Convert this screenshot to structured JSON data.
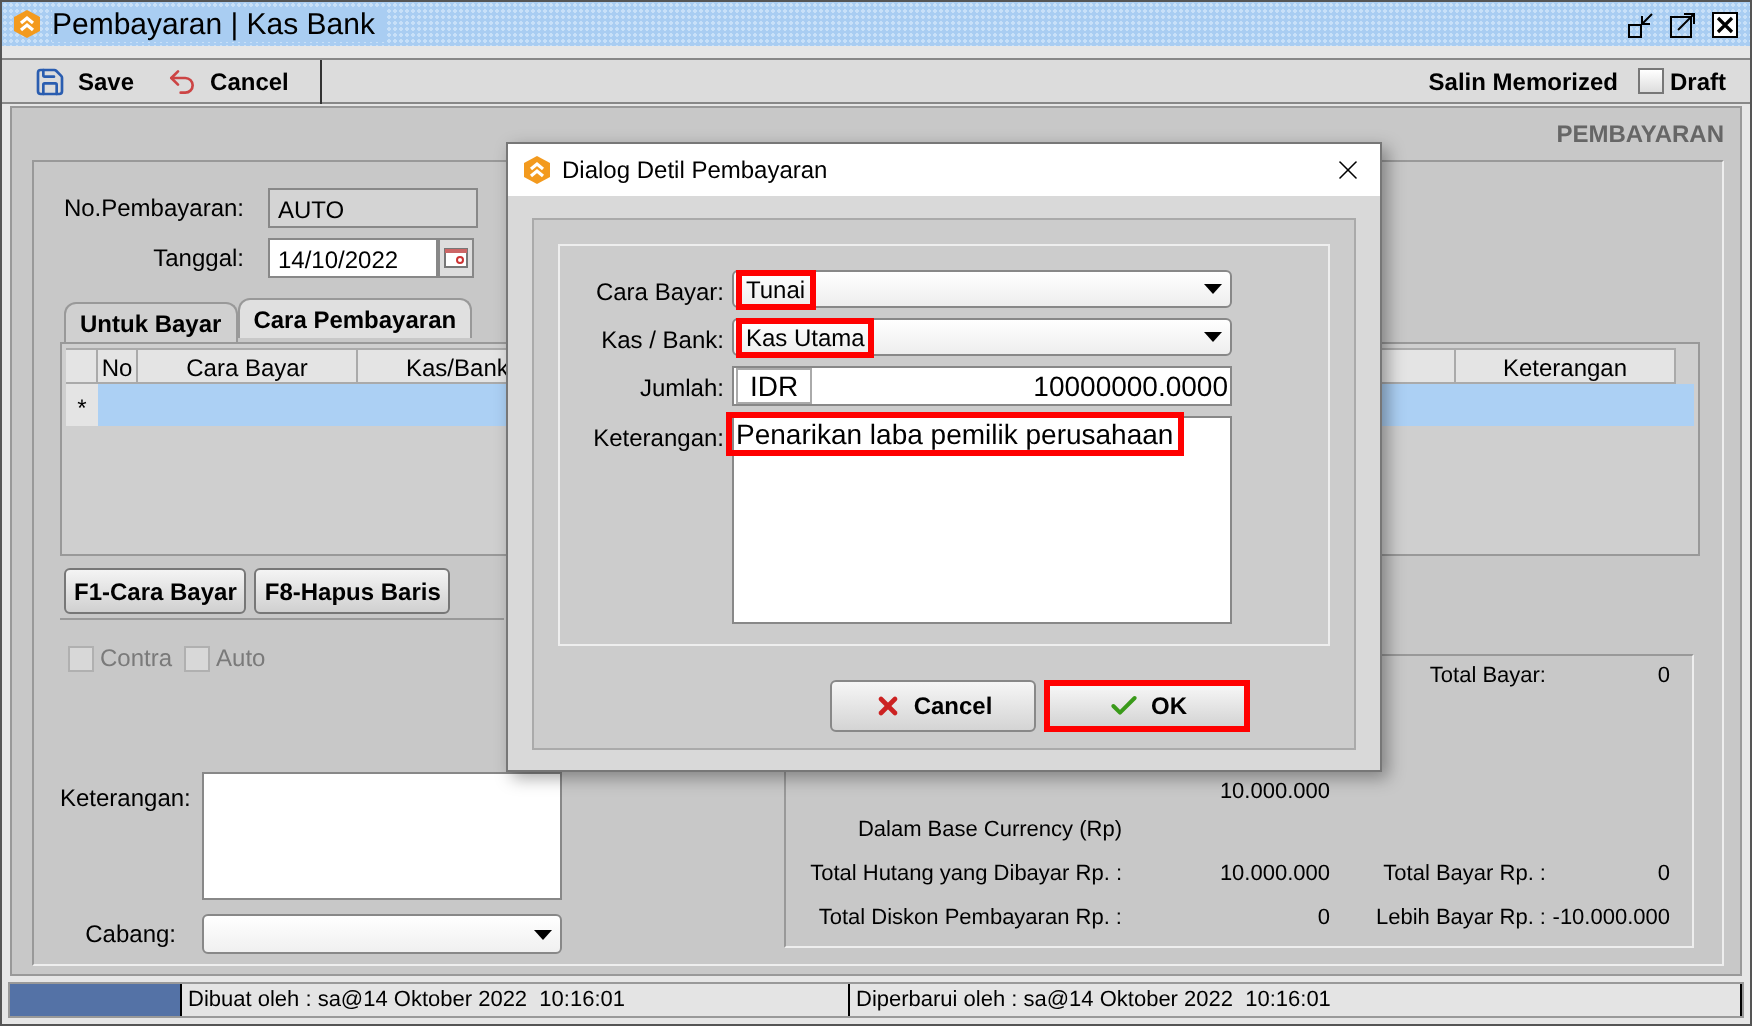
{
  "window": {
    "title": "Pembayaran | Kas Bank"
  },
  "toolbar": {
    "buttons": [
      {
        "label": "Save",
        "kind": "save"
      },
      {
        "label": "Cancel",
        "kind": "cancel"
      }
    ],
    "memorized": "Salin Memorized",
    "draft": {
      "label": "Draft",
      "checked": false
    }
  },
  "form_type": "PEMBAYARAN",
  "fields": [
    {
      "label": "No.Pembayaran:",
      "value": "AUTO",
      "kind": "readonly"
    },
    {
      "label": "Tanggal:",
      "value": "14/10/2022",
      "kind": "date"
    }
  ],
  "tabs": [
    {
      "label": "Untuk Bayar",
      "selected": false
    },
    {
      "label": "Cara Pembayaran",
      "selected": true
    }
  ],
  "table": {
    "columns": [
      "No",
      "Cara Bayar",
      "Kas/Bank",
      "Keterangan"
    ],
    "rows": [
      {
        "marker": "*",
        "selected": true
      }
    ]
  },
  "table_buttons": [
    "F1-Cara Bayar",
    "F8-Hapus Baris"
  ],
  "options": [
    {
      "label": "Contra",
      "checked": false,
      "disabled": true
    },
    {
      "label": "Auto",
      "checked": false,
      "disabled": true
    }
  ],
  "keterangan": {
    "label": "Keterangan:"
  },
  "cabang": {
    "label": "Cabang:"
  },
  "summary": {
    "total_bayar": {
      "label": "Total Bayar:",
      "value": "0"
    },
    "amount": "10.000.000",
    "base_currency": "Dalam Base Currency (Rp)",
    "rows": [
      {
        "label": "Total Hutang yang Dibayar Rp. :",
        "value": "10.000.000",
        "label_2": "Total Bayar Rp. :",
        "value_2": "0"
      },
      {
        "label": "Total Diskon Pembayaran Rp. :",
        "value": "0",
        "label_2": "Lebih Bayar Rp. :",
        "value_2": "-10.000.000"
      }
    ]
  },
  "status_bar": {
    "created": "Dibuat oleh : sa@14 Oktober 2022  10:16:01",
    "updated": "Diperbarui oleh : sa@14 Oktober 2022  10:16:01"
  },
  "dialog": {
    "title": "Dialog Detil Pembayaran",
    "fields": [
      {
        "label": "Cara Bayar:",
        "kind": "select",
        "value": "Tunai",
        "highlighted": true
      },
      {
        "label": "Kas / Bank:",
        "kind": "select",
        "value": "Kas Utama",
        "highlighted": true
      },
      {
        "label": "Jumlah:",
        "kind": "amount",
        "currency": "IDR",
        "value": "10000000.0000",
        "highlighted": false
      },
      {
        "label": "Keterangan:",
        "kind": "textarea",
        "value": "Penarikan laba pemilik perusahaan",
        "highlighted": true
      }
    ],
    "buttons": [
      {
        "label": "Cancel",
        "kind": "cancel",
        "highlighted": false
      },
      {
        "label": "OK",
        "kind": "ok",
        "highlighted": true
      }
    ]
  }
}
